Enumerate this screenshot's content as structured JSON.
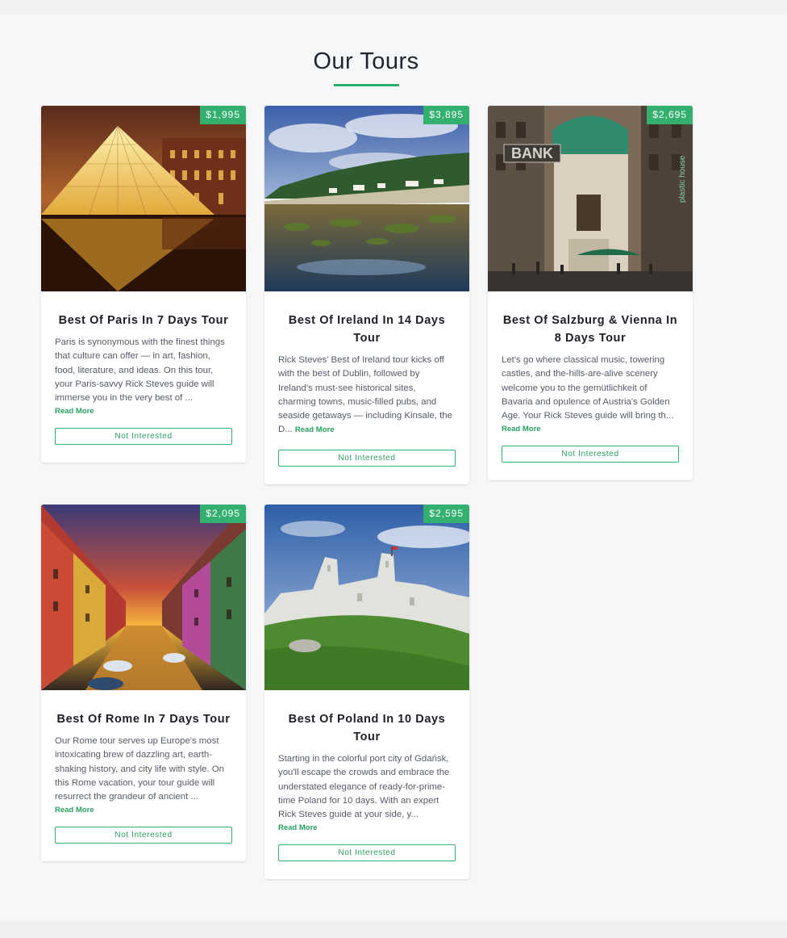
{
  "section": {
    "title": "Our Tours"
  },
  "colors": {
    "accent": "#33b06f",
    "background": "#f6f7f9",
    "card": "#ffffff"
  },
  "tours": [
    {
      "price": "$1,995",
      "title": "Best Of Paris In 7 Days Tour",
      "description": "Paris is synonymous with the finest things that culture can offer — in art, fashion, food, literature, and ideas. On this tour, your Paris-savvy Rick Steves guide will immerse you in the very best of ...",
      "read_more": "Read More",
      "button": "Not Interested",
      "image": "louvre-pyramid-night"
    },
    {
      "price": "$3,895",
      "title": "Best Of Ireland In 14 Days Tour",
      "description": "Rick Steves' Best of Ireland tour kicks off with the best of Dublin, followed by Ireland's must-see historical sites, charming towns, music-filled pubs, and seaside getaways — including Kinsale, the D...",
      "read_more": "Read More",
      "button": "Not Interested",
      "image": "irish-coast-village"
    },
    {
      "price": "$2,695",
      "title": "Best Of Salzburg & Vienna In 8 Days Tour",
      "description": "Let's go where classical music, towering castles, and the-hills-are-alive scenery welcome you to the gemütlichkeit of Bavaria and opulence of Austria's Golden Age. Your Rick Steves guide will bring th...",
      "read_more": "Read More",
      "button": "Not Interested",
      "image": "vienna-street",
      "image_signs": {
        "bank": "BANK",
        "plastic": "plastic house"
      }
    },
    {
      "price": "$2,095",
      "title": "Best Of Rome In 7 Days Tour",
      "description": "Our Rome tour serves up Europe's most intoxicating brew of dazzling art, earth-shaking history, and city life with style. On this Rome vacation, your tour guide will resurrect the grandeur of ancient ...",
      "read_more": "Read More",
      "button": "Not Interested",
      "image": "canal-sunset"
    },
    {
      "price": "$2,595",
      "title": "Best Of Poland In 10 Days Tour",
      "description": "Starting in the colorful port city of Gdańsk, you'll escape the crowds and embrace the understated elegance of ready-for-prime-time Poland for 10 days. With an expert Rick Steves guide at your side, y...",
      "read_more": "Read More",
      "button": "Not Interested",
      "image": "castle-ruins-hill"
    }
  ]
}
